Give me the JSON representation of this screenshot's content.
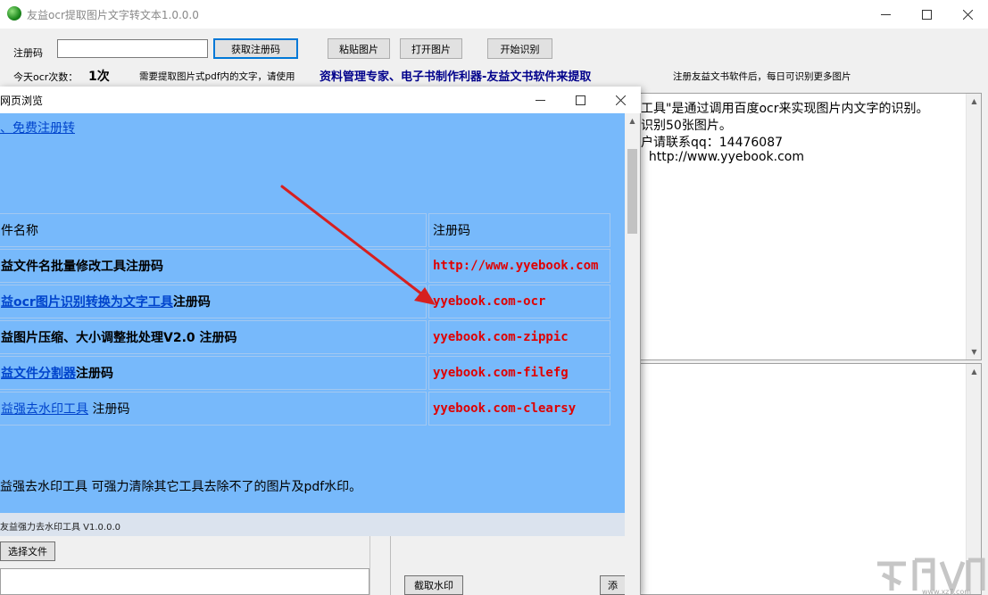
{
  "app": {
    "title": "友益ocr提取图片文字转文本1.0.0.0"
  },
  "toolbar": {
    "reg_label": "注册码",
    "reg_value": "",
    "get_code_button": "获取注册码",
    "paste_button": "粘贴图片",
    "open_button": "打开图片",
    "start_button": "开始识别"
  },
  "status": {
    "today_label": "今天ocr次数：",
    "today_count": "1次",
    "hint_prefix": "需要提取图片式pdf内的文字，请使用",
    "hint_bold": "资料管理专家、电子书制作利器-友益文书软件来提取",
    "hint_suffix": "注册友益文书软件后，每日可识别更多图片"
  },
  "info_panel": {
    "lines": [
      "工具\"是通过调用百度ocr来实现图片内文字的识别。",
      "识别50张图片。",
      "户请联系qq：14476087",
      "  http://www.yyebook.com"
    ]
  },
  "browse_window": {
    "title": "网页浏览",
    "link_text": "、免费注册转",
    "table": {
      "header": [
        "件名称",
        "注册码"
      ],
      "rows": [
        {
          "prefix": "益文件名批量修改工具注册码",
          "link": "",
          "suffix": "",
          "code": "http://www.yyebook.com"
        },
        {
          "prefix": "",
          "link": "益ocr图片识别转换为文字工具",
          "suffix": "注册码",
          "code": "yyebook.com-ocr"
        },
        {
          "prefix": "益图片压缩、大小调整批处理V2.0 注册码",
          "link": "",
          "suffix": "",
          "code": "yyebook.com-zippic"
        },
        {
          "prefix": "",
          "link": "益文件分割器",
          "suffix": "注册码",
          "code": "yyebook.com-filefg"
        },
        {
          "prefix": "",
          "link": "益强去水印工具",
          "suffix": " 注册码",
          "code": "yyebook.com-clearsy"
        }
      ]
    },
    "description": "益强去水印工具 可强力清除其它工具去除不了的图片及pdf水印。",
    "sub_window": {
      "title": "友益强力去水印工具 V1.0.0.0",
      "select_button": "选择文件",
      "extract_button": "截取水印",
      "add_button": "添"
    }
  },
  "colors": {
    "browse_bg": "#77b9fb",
    "code_red": "#e00000",
    "link_blue": "#0044cc",
    "arrow_red": "#d62020"
  }
}
